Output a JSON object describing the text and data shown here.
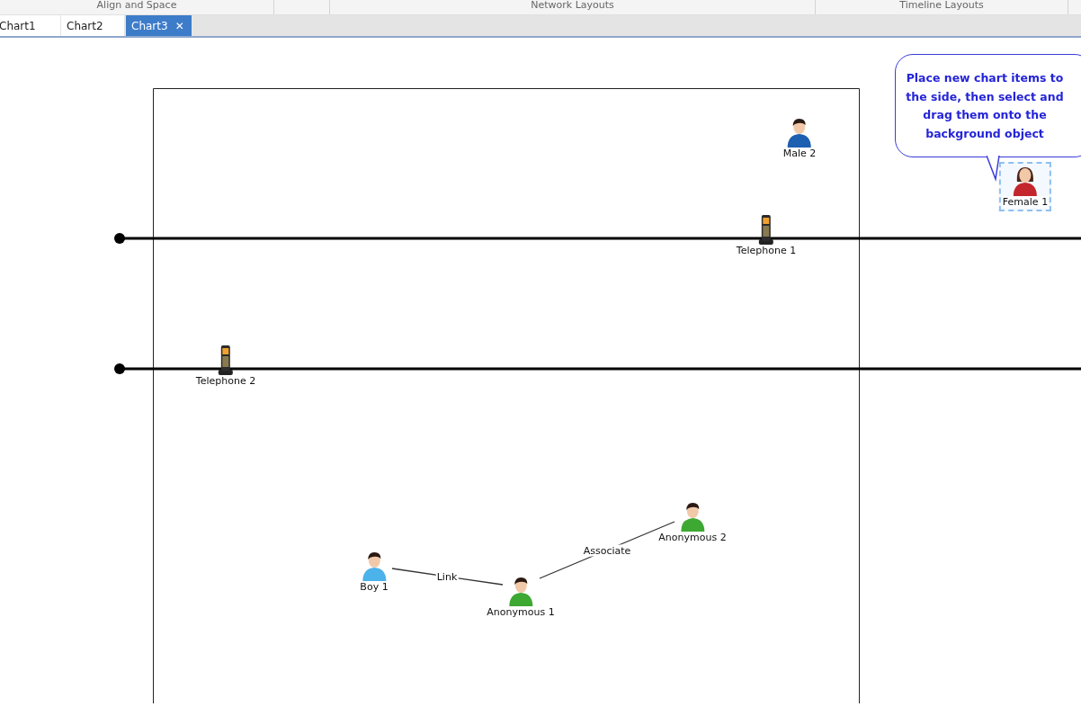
{
  "ribbon_groups": [
    {
      "label": "Align and Space"
    },
    {
      "label": "Network Layouts"
    },
    {
      "label": "Timeline Layouts"
    }
  ],
  "tabs": [
    {
      "label": "Chart1",
      "selected": false
    },
    {
      "label": "Chart2",
      "selected": false
    },
    {
      "label": "Chart3",
      "selected": true,
      "close_glyph": "✕"
    }
  ],
  "callout": {
    "text": "Place new chart items to the side, then select and drag them onto the background object"
  },
  "nodes": [
    {
      "label": "Male 2",
      "kind": "male",
      "selected": false
    },
    {
      "label": "Female 1",
      "kind": "female",
      "selected": true
    },
    {
      "label": "Telephone 1",
      "kind": "telephone",
      "selected": false
    },
    {
      "label": "Telephone 2",
      "kind": "telephone",
      "selected": false
    },
    {
      "label": "Boy 1",
      "kind": "boy",
      "selected": false
    },
    {
      "label": "Anonymous 1",
      "kind": "anonymous",
      "selected": false
    },
    {
      "label": "Anonymous 2",
      "kind": "anonymous",
      "selected": false
    }
  ],
  "links": [
    {
      "label": "Link"
    },
    {
      "label": "Associate"
    }
  ]
}
